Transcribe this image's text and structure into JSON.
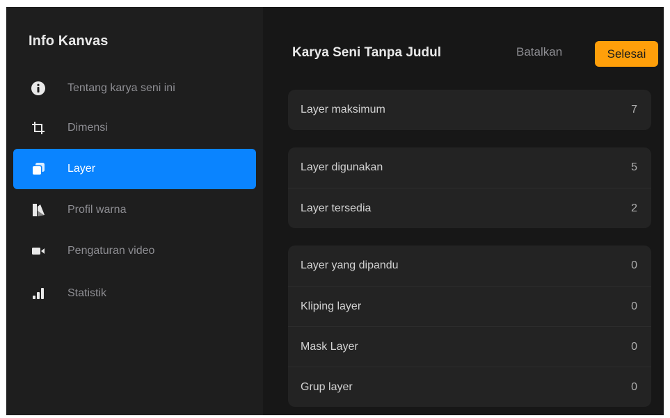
{
  "sidebar": {
    "title": "Info Kanvas",
    "items": [
      {
        "label": "Tentang karya seni ini",
        "icon": "info-icon"
      },
      {
        "label": "Dimensi",
        "icon": "crop-icon"
      },
      {
        "label": "Layer",
        "icon": "layers-icon",
        "active": true
      },
      {
        "label": "Profil warna",
        "icon": "color-profile-icon"
      },
      {
        "label": "Pengaturan video",
        "icon": "video-camera-icon"
      },
      {
        "label": "Statistik",
        "icon": "bar-chart-icon"
      }
    ]
  },
  "header": {
    "title": "Karya Seni Tanpa Judul",
    "cancel_label": "Batalkan",
    "done_label": "Selesai"
  },
  "groups": [
    [
      {
        "label": "Layer maksimum",
        "value": "7"
      }
    ],
    [
      {
        "label": "Layer digunakan",
        "value": "5"
      },
      {
        "label": "Layer tersedia",
        "value": "2"
      }
    ],
    [
      {
        "label": "Layer yang dipandu",
        "value": "0"
      },
      {
        "label": "Kliping layer",
        "value": "0"
      },
      {
        "label": "Mask Layer",
        "value": "0"
      },
      {
        "label": "Grup layer",
        "value": "0"
      }
    ]
  ],
  "colors": {
    "accent": "#0a84ff",
    "done_button": "#ff9f0a",
    "background": "#171717",
    "sidebar": "#1e1e1e"
  }
}
